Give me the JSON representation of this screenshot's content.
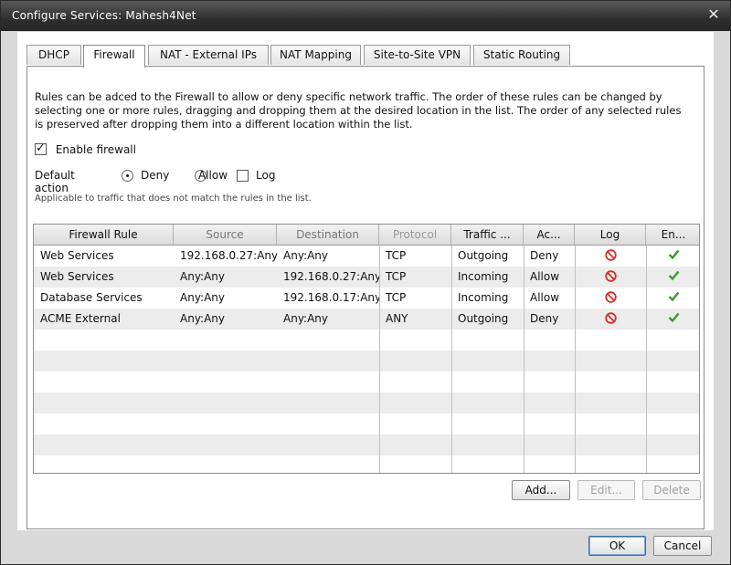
{
  "window": {
    "title": "Configure Services: Mahesh4Net",
    "close_glyph": "✕"
  },
  "tabs": [
    {
      "label": "DHCP",
      "active": false
    },
    {
      "label": "Firewall",
      "active": true
    },
    {
      "label": "NAT - External IPs",
      "active": false
    },
    {
      "label": "NAT Mapping",
      "active": false
    },
    {
      "label": "Site-to-Site VPN",
      "active": false
    },
    {
      "label": "Static Routing",
      "active": false
    }
  ],
  "description": "Rules can be adced to the Firewall to allow or deny specific network traffic. The order of these rules can be changed by selecting one or more rules, dragging and dropping them at the desired location in the list. The order of any selected rules is preserved after dropping them into a different location within the list.",
  "enable_firewall": {
    "label": "Enable firewall",
    "checked": true
  },
  "default_action": {
    "label": "Default action",
    "deny_label": "Deny",
    "allow_label": "Allow",
    "log_label": "Log",
    "selected": "Deny",
    "log_checked": false
  },
  "hint": "Applicable to traffic that does not match the rules in the list.",
  "table": {
    "columns": [
      "Firewall Rule",
      "Source",
      "Destination",
      "Protocol",
      "Traffic ...",
      "Ac...",
      "Log",
      "En..."
    ],
    "rows": [
      {
        "rule": "Web Services",
        "source": "192.168.0.27:Any",
        "destination": "Any:Any",
        "protocol": "TCP",
        "traffic": "Outgoing",
        "action": "Deny",
        "log": "deny-icon",
        "enabled": "check-icon"
      },
      {
        "rule": "Web Services",
        "source": "Any:Any",
        "destination": "192.168.0.27:Any",
        "protocol": "TCP",
        "traffic": "Incoming",
        "action": "Allow",
        "log": "deny-icon",
        "enabled": "check-icon"
      },
      {
        "rule": "Database Services",
        "source": "Any:Any",
        "destination": "192.168.0.17:Any",
        "protocol": "TCP",
        "traffic": "Incoming",
        "action": "Allow",
        "log": "deny-icon",
        "enabled": "check-icon"
      },
      {
        "rule": "ACME External",
        "source": "Any:Any",
        "destination": "Any:Any",
        "protocol": "ANY",
        "traffic": "Outgoing",
        "action": "Deny",
        "log": "deny-icon",
        "enabled": "check-icon"
      }
    ]
  },
  "buttons": {
    "add": "Add...",
    "edit": "Edit...",
    "delete": "Delete",
    "ok": "OK",
    "cancel": "Cancel"
  },
  "colors": {
    "deny_icon": "#d0302a",
    "check_icon": "#3a9a2a"
  }
}
